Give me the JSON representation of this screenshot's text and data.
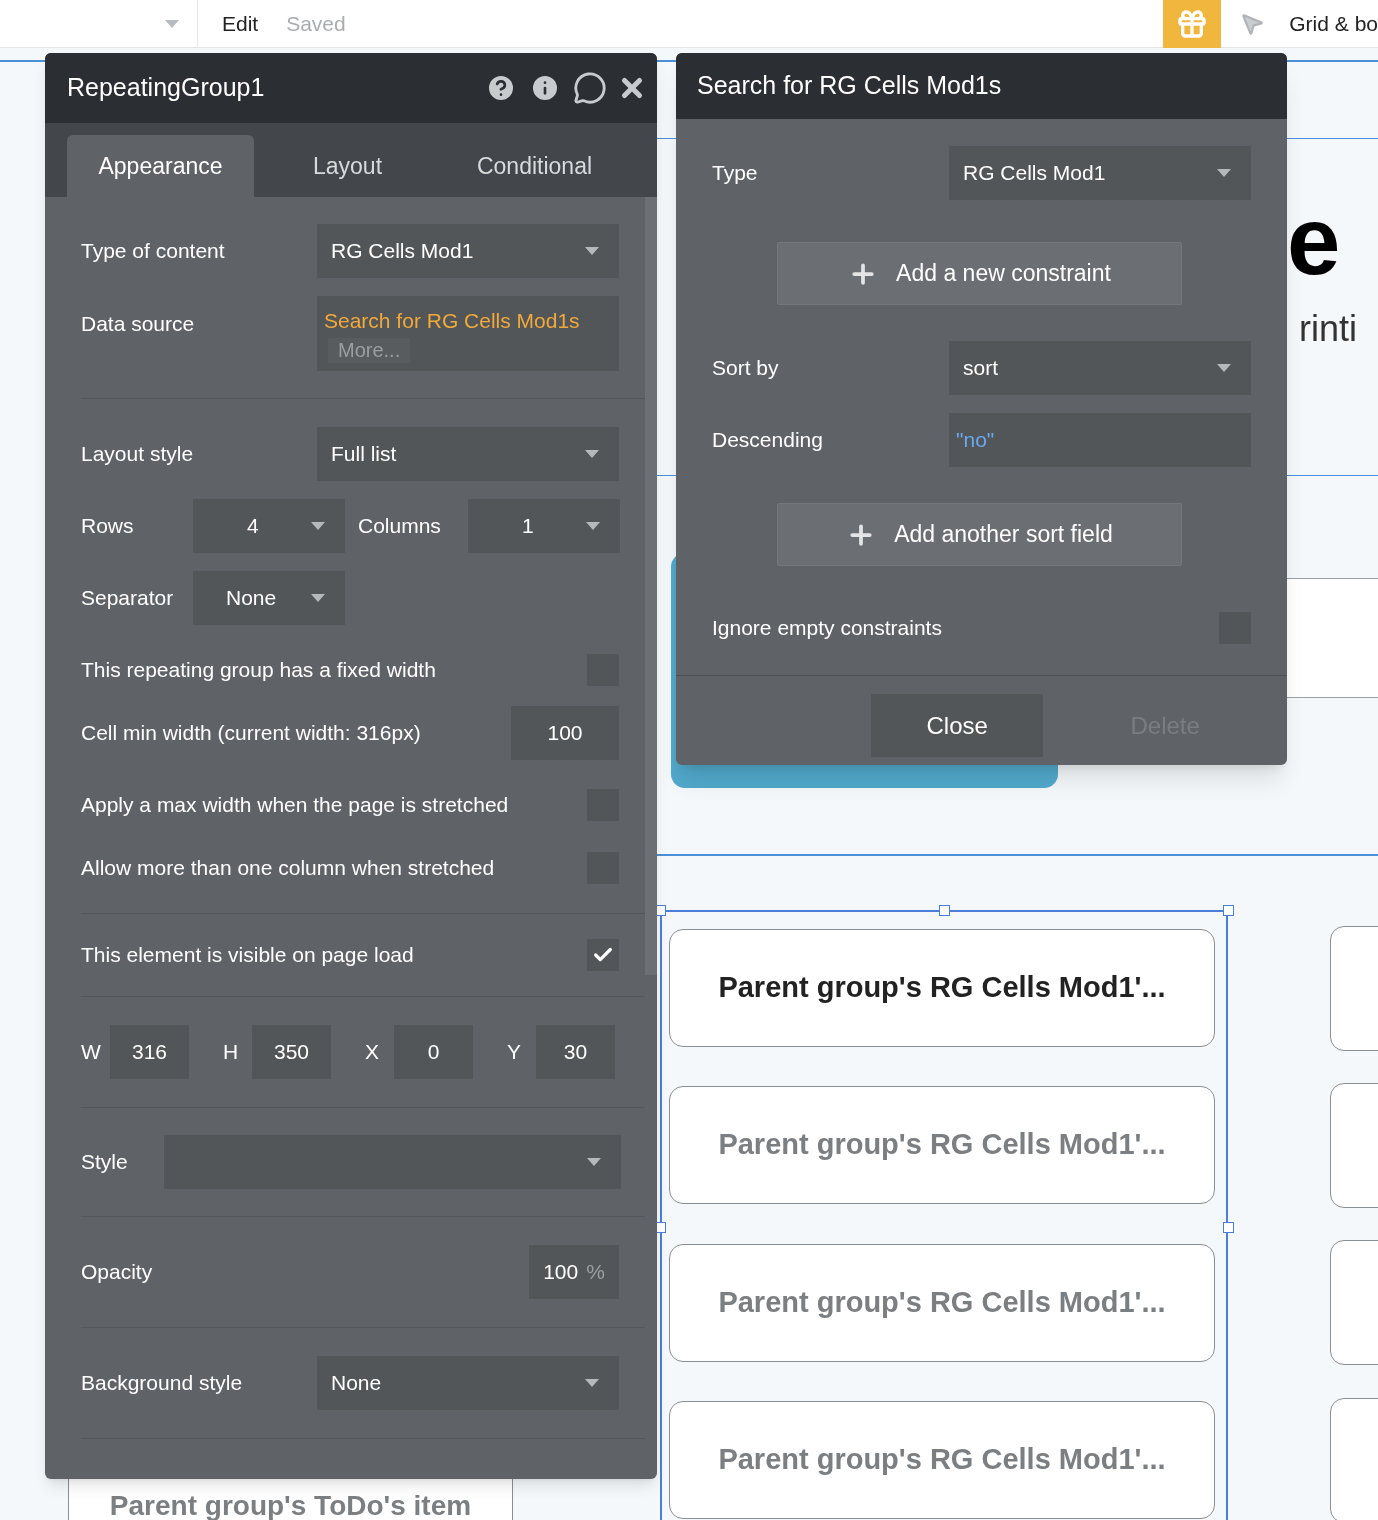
{
  "top_bar": {
    "menu": "Edit",
    "status": "Saved",
    "view_label": "Grid & bo"
  },
  "canvas": {
    "text_fragments": [
      {
        "kind": "heading-right",
        "text": "e"
      },
      {
        "kind": "body-right",
        "text": "rinti"
      }
    ],
    "cells": [
      {
        "text": "Parent group's RG Cells Mod1'...",
        "dimmed": false
      },
      {
        "text": "Parent group's RG Cells Mod1'...",
        "dimmed": true
      },
      {
        "text": "Parent group's RG Cells Mod1'...",
        "dimmed": true
      },
      {
        "text": "Parent group's RG Cells Mod1'...",
        "dimmed": true
      }
    ],
    "bottom_cell": "Parent group's ToDo's item"
  },
  "properties_panel": {
    "title": "RepeatingGroup1",
    "tabs": [
      {
        "label": "Appearance",
        "selected": true
      },
      {
        "label": "Layout",
        "selected": false
      },
      {
        "label": "Conditional",
        "selected": false
      }
    ],
    "type_of_content": {
      "label": "Type of content",
      "value": "RG Cells Mod1"
    },
    "data_source": {
      "label": "Data source",
      "value": "Search for RG Cells Mod1s",
      "more": "More..."
    },
    "layout_style": {
      "label": "Layout style",
      "value": "Full list"
    },
    "rows": {
      "label": "Rows",
      "value": "4"
    },
    "columns": {
      "label": "Columns",
      "value": "1"
    },
    "separator": {
      "label": "Separator",
      "value": "None"
    },
    "fixed_width": {
      "label": "This repeating group has a fixed width",
      "checked": false
    },
    "cell_min_width": {
      "label": "Cell min width (current width: 316px)",
      "value": "100"
    },
    "max_width": {
      "label": "Apply a max width when the page is stretched",
      "checked": false
    },
    "multi_column": {
      "label": "Allow more than one column when stretched",
      "checked": false
    },
    "visible_on_load": {
      "label": "This element is visible on page load",
      "checked": true
    },
    "geometry": [
      {
        "label": "W",
        "value": "316"
      },
      {
        "label": "H",
        "value": "350"
      },
      {
        "label": "X",
        "value": "0"
      },
      {
        "label": "Y",
        "value": "30"
      }
    ],
    "style": {
      "label": "Style"
    },
    "opacity": {
      "label": "Opacity",
      "value": "100",
      "unit": "%"
    },
    "background_style": {
      "label": "Background style",
      "value": "None"
    }
  },
  "search_panel": {
    "title": "Search for RG Cells Mod1s",
    "type": {
      "label": "Type",
      "value": "RG Cells Mod1"
    },
    "add_constraint": "Add a new constraint",
    "sort_by": {
      "label": "Sort by",
      "value": "sort"
    },
    "descending": {
      "label": "Descending",
      "value": "\"no\""
    },
    "add_sort": "Add another sort field",
    "ignore_empty": {
      "label": "Ignore empty constraints",
      "checked": false
    },
    "buttons": [
      {
        "label": "Close",
        "disabled": false
      },
      {
        "label": "Delete",
        "disabled": true
      }
    ]
  }
}
